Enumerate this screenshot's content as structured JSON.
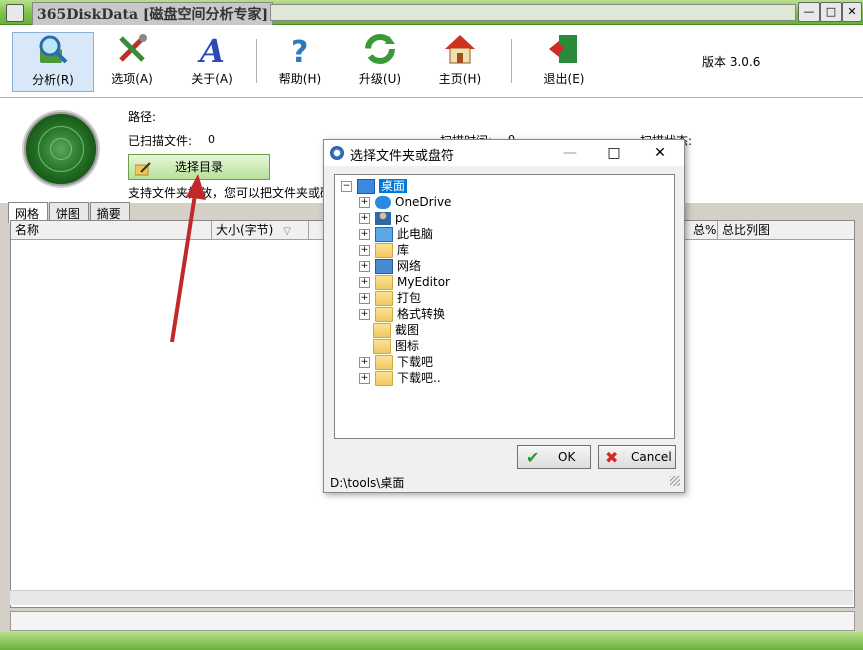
{
  "window": {
    "title": "365DiskData [磁盘空间分析专家]",
    "min_glyph": "—",
    "max_glyph": "□",
    "close_glyph": "✕"
  },
  "toolbar": {
    "items": [
      {
        "label": "分析(R)",
        "icon": "analyze-magnifier-icon"
      },
      {
        "label": "选项(A)",
        "icon": "tools-icon"
      },
      {
        "label": "关于(A)",
        "icon": "about-a-icon"
      },
      {
        "label": "帮助(H)",
        "icon": "help-question-icon"
      },
      {
        "label": "升级(U)",
        "icon": "upgrade-recycle-icon"
      },
      {
        "label": "主页(H)",
        "icon": "home-icon"
      },
      {
        "label": "退出(E)",
        "icon": "exit-door-icon"
      }
    ],
    "version": "版本 3.0.6"
  },
  "info": {
    "path_label": "路径:",
    "scanned_files_label": "已扫描文件:",
    "scanned_files_value": "0",
    "scan_time_label": "扫描时间:",
    "scan_time_value": "0",
    "scan_status_label": "扫描状态:",
    "select_dir_label": "选择目录",
    "hint": "支持文件夹拖放，您可以把文件夹或磁"
  },
  "tabs": [
    "网格",
    "饼图",
    "摘要"
  ],
  "grid": {
    "columns": [
      "名称",
      "大小(字节)",
      "总%",
      "总比列图"
    ]
  },
  "dialog": {
    "title": "选择文件夹或盘符",
    "close_glyph": "✕",
    "min_glyph": "—",
    "max_glyph": "□",
    "tree": [
      {
        "label": "桌面",
        "expander": "⊟",
        "icon": "desktop-icon",
        "selected": true
      },
      {
        "label": "OneDrive",
        "expander": "+",
        "icon": "onedrive-cloud-icon"
      },
      {
        "label": "pc",
        "expander": "+",
        "icon": "user-icon"
      },
      {
        "label": "此电脑",
        "expander": "+",
        "icon": "computer-icon"
      },
      {
        "label": "库",
        "expander": "+",
        "icon": "library-icon"
      },
      {
        "label": "网络",
        "expander": "+",
        "icon": "network-icon"
      },
      {
        "label": "MyEditor",
        "expander": "+",
        "icon": "folder-icon"
      },
      {
        "label": "打包",
        "expander": "+",
        "icon": "folder-icon"
      },
      {
        "label": "格式转换",
        "expander": "+",
        "icon": "folder-icon"
      },
      {
        "label": "截图",
        "expander": "",
        "icon": "folder-icon"
      },
      {
        "label": "图标",
        "expander": "",
        "icon": "folder-icon"
      },
      {
        "label": "下载吧",
        "expander": "+",
        "icon": "folder-icon"
      },
      {
        "label": "下载吧..",
        "expander": "+",
        "icon": "folder-icon"
      }
    ],
    "ok_label": "OK",
    "cancel_label": "Cancel",
    "status_path": "D:\\tools\\桌面"
  },
  "colors": {
    "titlebar_green": "#7cc24a",
    "arrow_red": "#c0282a",
    "selection_blue": "#0078d7"
  }
}
